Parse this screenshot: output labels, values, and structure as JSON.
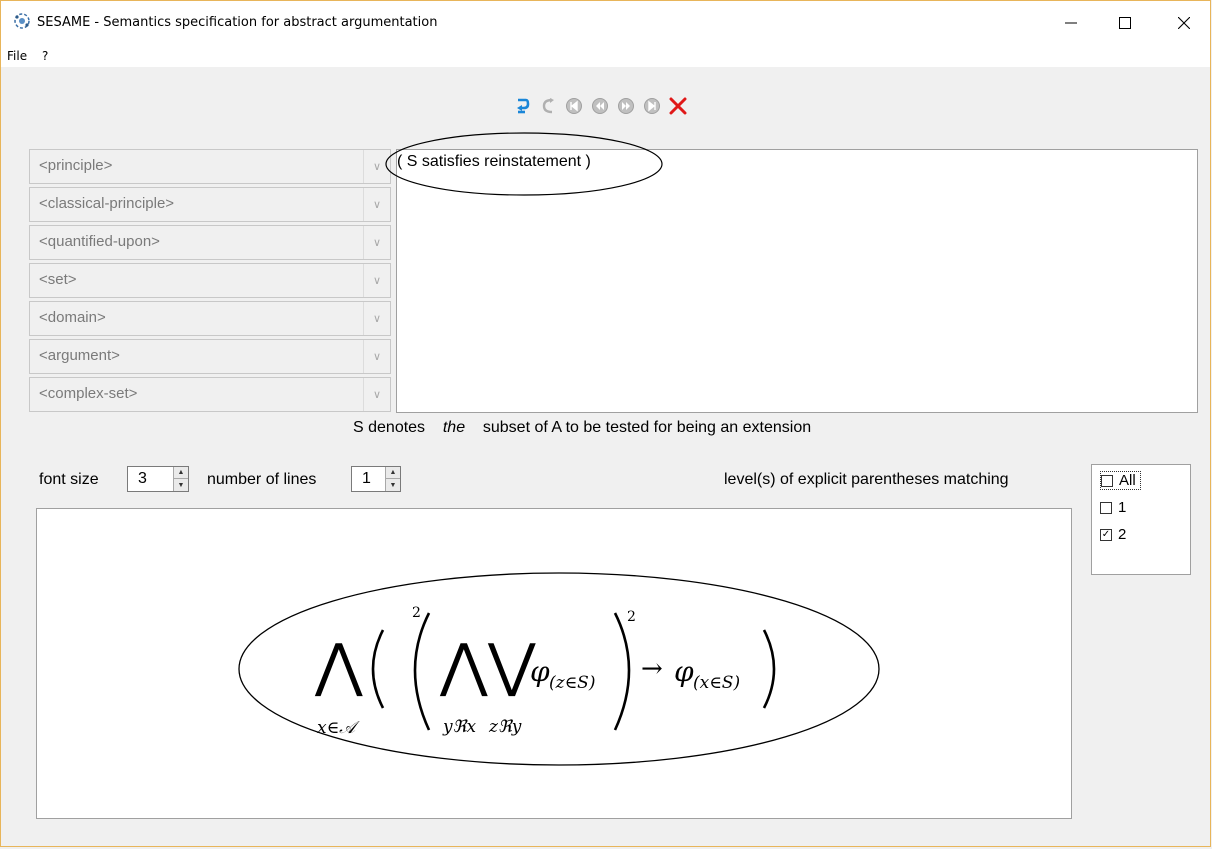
{
  "window": {
    "title": "SESAME - Semantics specification for abstract argumentation",
    "controls": [
      "minimize",
      "maximize",
      "close"
    ]
  },
  "menu": {
    "items": [
      "File",
      "?"
    ]
  },
  "toolbar": {
    "buttons": [
      "undo-icon",
      "redo-icon",
      "first-icon",
      "previous-icon",
      "next-icon",
      "last-icon",
      "delete-icon"
    ],
    "colors": {
      "undo": "#1a86d8",
      "delete": "#e01818",
      "disabled": "#b0b0b0"
    }
  },
  "dropdowns": [
    {
      "label": "<principle>"
    },
    {
      "label": "<classical-principle>"
    },
    {
      "label": "<quantified-upon>"
    },
    {
      "label": "<set>"
    },
    {
      "label": "<domain>"
    },
    {
      "label": "<argument>"
    },
    {
      "label": "<complex-set>"
    }
  ],
  "editor": {
    "text": "( S satisfies reinstatement )"
  },
  "note": {
    "before": "S denotes",
    "emph": "the",
    "after": "subset of A to be tested for being an extension"
  },
  "controls": {
    "font_size_label": "font size",
    "font_size_value": "3",
    "lines_label": "number of lines",
    "lines_value": "1",
    "levels_label": "level(s) of explicit parentheses matching"
  },
  "levels": [
    {
      "label": "All",
      "checked": false
    },
    {
      "label": "1",
      "checked": false
    },
    {
      "label": "2",
      "checked": true
    }
  ],
  "formula": {
    "big_and": "⋀",
    "big_or": "⋁",
    "outer_sub": "x∈𝒜",
    "inner_and_sub": "yℜx",
    "inner_or_sub": "zℜy",
    "phi": "φ",
    "phi_sub_1": "(z∈S)",
    "phi_sub_2": "(x∈S)",
    "arrow": "→",
    "level_mark_1": "2",
    "level_mark_2": "2"
  }
}
